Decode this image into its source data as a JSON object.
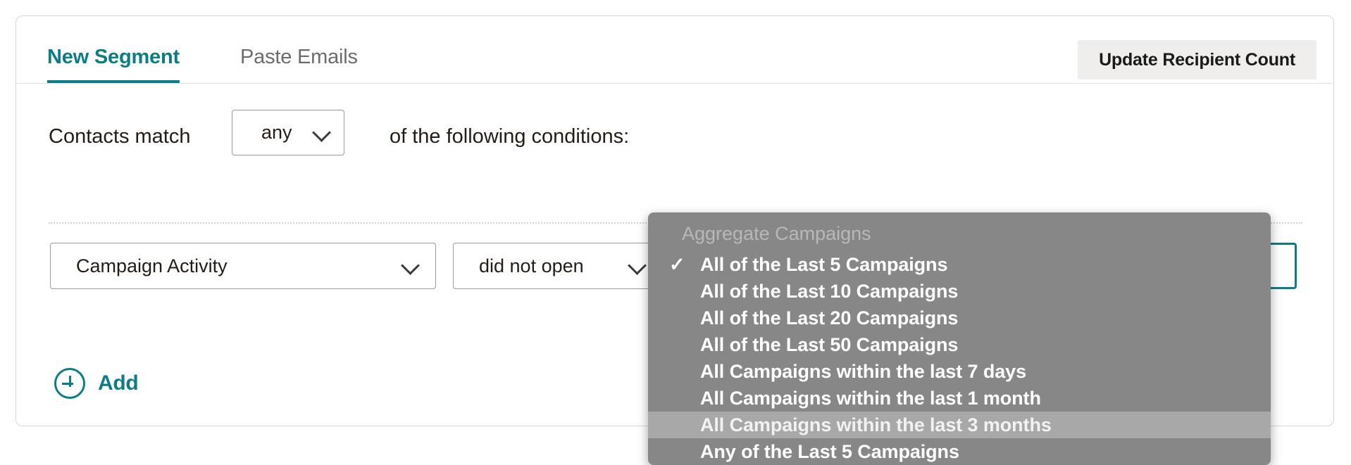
{
  "tabs": [
    {
      "label": "New Segment",
      "active": true
    },
    {
      "label": "Paste Emails",
      "active": false
    }
  ],
  "toolbar": {
    "update_recipient_count_label": "Update Recipient Count"
  },
  "match_row": {
    "prefix_label": "Contacts match",
    "select_value": "any",
    "suffix_label": "of the following conditions:"
  },
  "condition": {
    "field_value": "Campaign Activity",
    "operator_value": "did not open",
    "value_input": ""
  },
  "add": {
    "label": "Add",
    "icon": "plus-circle-icon"
  },
  "dropdown": {
    "group_label": "Aggregate Campaigns",
    "check_glyph": "✓",
    "background_color": "#878787",
    "highlight_color": "#a8a8a8",
    "items": [
      {
        "label": "All of the Last 5 Campaigns",
        "checked": true,
        "highlighted": false
      },
      {
        "label": "All of the Last 10 Campaigns",
        "checked": false,
        "highlighted": false
      },
      {
        "label": "All of the Last 20 Campaigns",
        "checked": false,
        "highlighted": false
      },
      {
        "label": "All of the Last 50 Campaigns",
        "checked": false,
        "highlighted": false
      },
      {
        "label": "All Campaigns within the last 7 days",
        "checked": false,
        "highlighted": false
      },
      {
        "label": "All Campaigns within the last 1 month",
        "checked": false,
        "highlighted": false
      },
      {
        "label": "All Campaigns within the last 3 months",
        "checked": false,
        "highlighted": true
      },
      {
        "label": "Any of the Last 5 Campaigns",
        "checked": false,
        "highlighted": false
      }
    ]
  },
  "colors": {
    "accent_teal": "#0d7d85",
    "muted_text": "#6c6c6c",
    "button_bg": "#efeeec",
    "card_border": "#d6d6d6"
  }
}
